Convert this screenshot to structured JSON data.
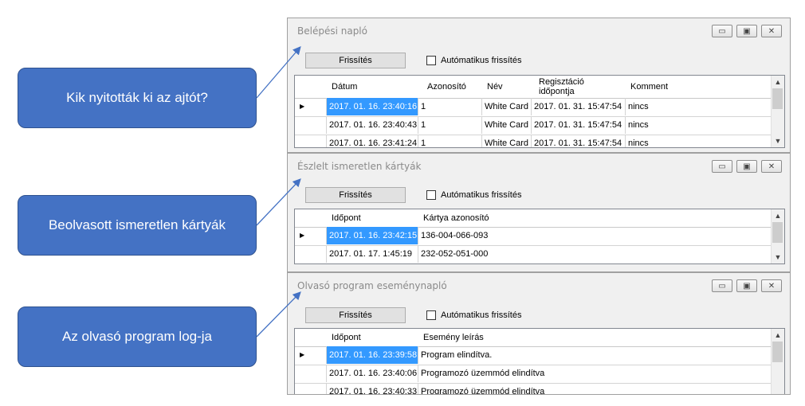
{
  "callouts": [
    {
      "text": "Kik nyitották ki az ajtót?"
    },
    {
      "text": "Beolvasott ismeretlen kártyák"
    },
    {
      "text": "Az olvasó program log-ja"
    }
  ],
  "common": {
    "refresh_label": "Frissítés",
    "auto_refresh_label": "Autómatikus frissítés",
    "window_buttons": {
      "minimize": "▭",
      "restore": "▣",
      "close": "✕"
    },
    "row_indicator": "▶",
    "scroll_up": "▲",
    "scroll_down": "▼"
  },
  "window1": {
    "title": "Belépési napló",
    "columns": [
      "Dátum",
      "Azonosító",
      "Név",
      "Regisztáció időpontja",
      "Komment"
    ],
    "rows": [
      [
        "2017. 01. 16. 23:40:16",
        "1",
        "White Card",
        "2017. 01. 31. 15:47:54",
        "nincs"
      ],
      [
        "2017. 01. 16. 23:40:43",
        "1",
        "White Card",
        "2017. 01. 31. 15:47:54",
        "nincs"
      ],
      [
        "2017. 01. 16. 23:41:24",
        "1",
        "White Card",
        "2017. 01. 31. 15:47:54",
        "nincs"
      ]
    ]
  },
  "window2": {
    "title": "Észlelt ismeretlen kártyák",
    "columns": [
      "Időpont",
      "Kártya azonosító"
    ],
    "rows": [
      [
        "2017. 01. 16. 23:42:15",
        "136-004-066-093"
      ],
      [
        "2017. 01. 17. 1:45:19",
        "232-052-051-000"
      ]
    ]
  },
  "window3": {
    "title": "Olvasó program eseménynapló",
    "columns": [
      "Időpont",
      "Esemény leírás"
    ],
    "rows": [
      [
        "2017. 01. 16. 23:39:58",
        "Program elindítva."
      ],
      [
        "2017. 01. 16. 23:40:06",
        "Programozó üzemmód elindítva"
      ],
      [
        "2017. 01. 16. 23:40:33",
        "Programozó üzemmód elindítva"
      ]
    ]
  }
}
